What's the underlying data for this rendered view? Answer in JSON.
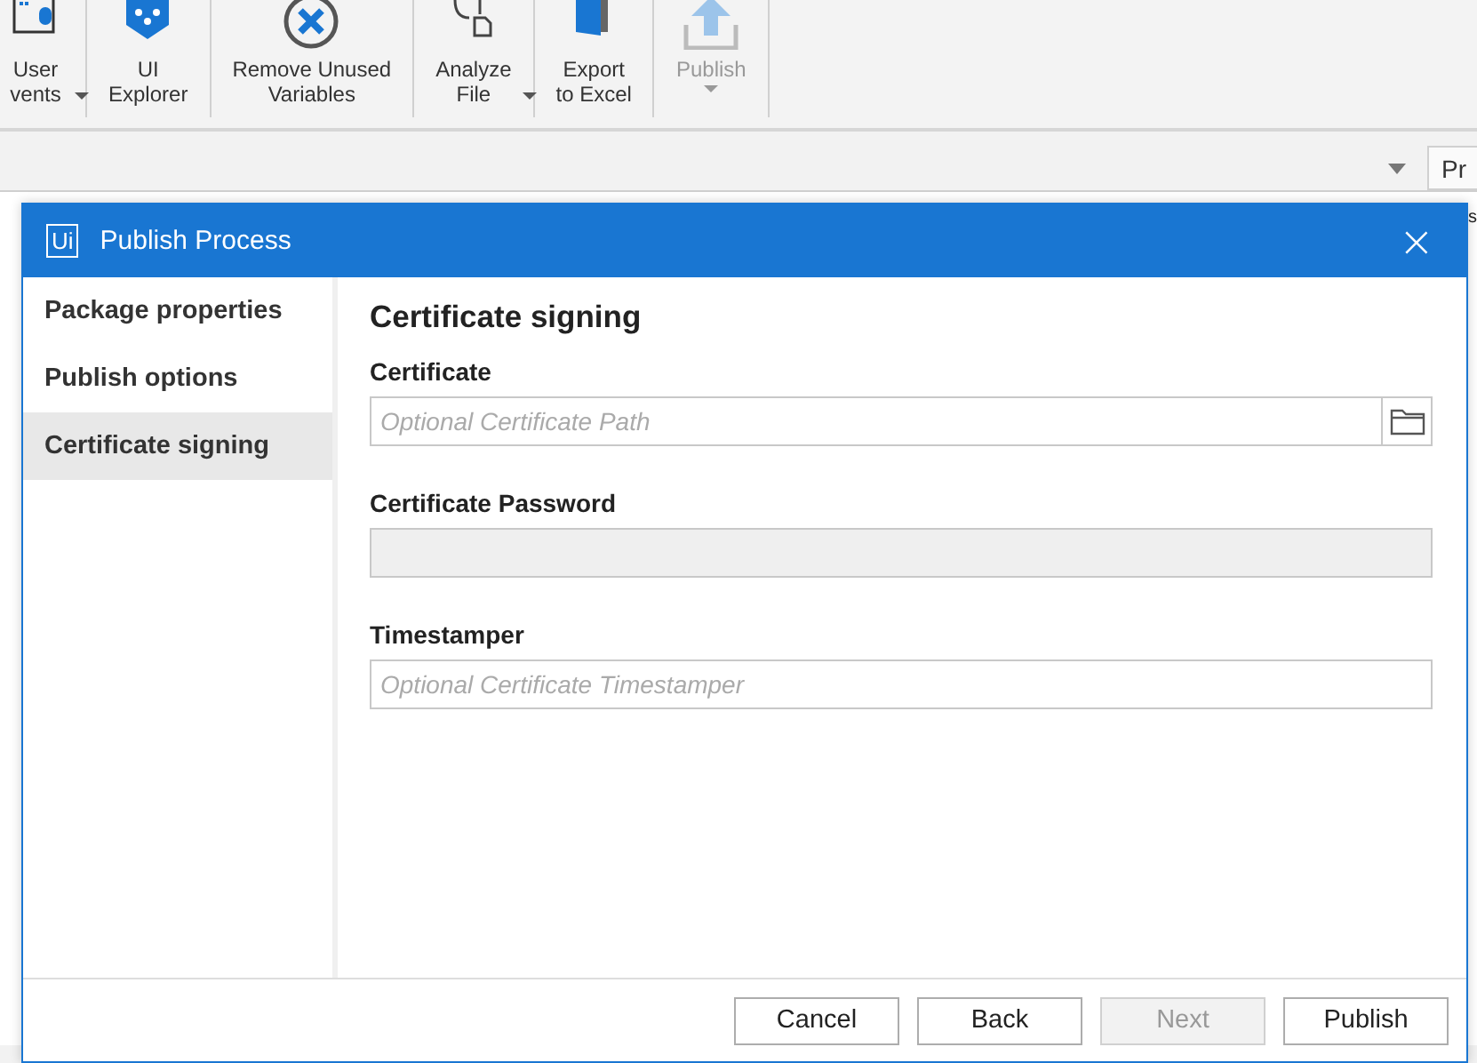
{
  "ribbon": {
    "buttons": [
      {
        "kind": "user-events",
        "lines": [
          "User",
          "vents"
        ],
        "dropdown": true,
        "disabled": false
      },
      {
        "kind": "ui-explorer",
        "lines": [
          "UI",
          "Explorer"
        ],
        "dropdown": false,
        "disabled": false
      },
      {
        "kind": "remove",
        "lines": [
          "Remove Unused",
          "Variables"
        ],
        "dropdown": false,
        "disabled": false
      },
      {
        "kind": "analyze",
        "lines": [
          "Analyze",
          "File"
        ],
        "dropdown": true,
        "disabled": false
      },
      {
        "kind": "excel",
        "lines": [
          "Export",
          "to Excel"
        ],
        "dropdown": false,
        "disabled": false
      },
      {
        "kind": "publish",
        "lines": [
          "Publish"
        ],
        "dropdown": true,
        "disabled": true
      }
    ]
  },
  "side_panel": {
    "tab": "Pr",
    "row_text": "s"
  },
  "dialog": {
    "logo": "Ui",
    "title": "Publish Process",
    "close": "×",
    "sidebar": {
      "items": [
        {
          "label": "Package properties",
          "selected": false
        },
        {
          "label": "Publish options",
          "selected": false
        },
        {
          "label": "Certificate signing",
          "selected": true
        }
      ]
    },
    "heading": "Certificate signing",
    "fields": [
      {
        "label": "Certificate",
        "placeholder": "Optional Certificate Path",
        "disabled": false,
        "browse": true
      },
      {
        "label": "Certificate Password",
        "disabled": true,
        "browse": false
      },
      {
        "label": "Timestamper",
        "placeholder": "Optional Certificate Timestamper",
        "disabled": false,
        "browse": false
      }
    ],
    "buttons": [
      {
        "label": "Cancel",
        "disabled": false
      },
      {
        "label": "Back",
        "disabled": false
      },
      {
        "label": "Next",
        "disabled": true
      },
      {
        "label": "Publish",
        "disabled": false
      }
    ]
  }
}
